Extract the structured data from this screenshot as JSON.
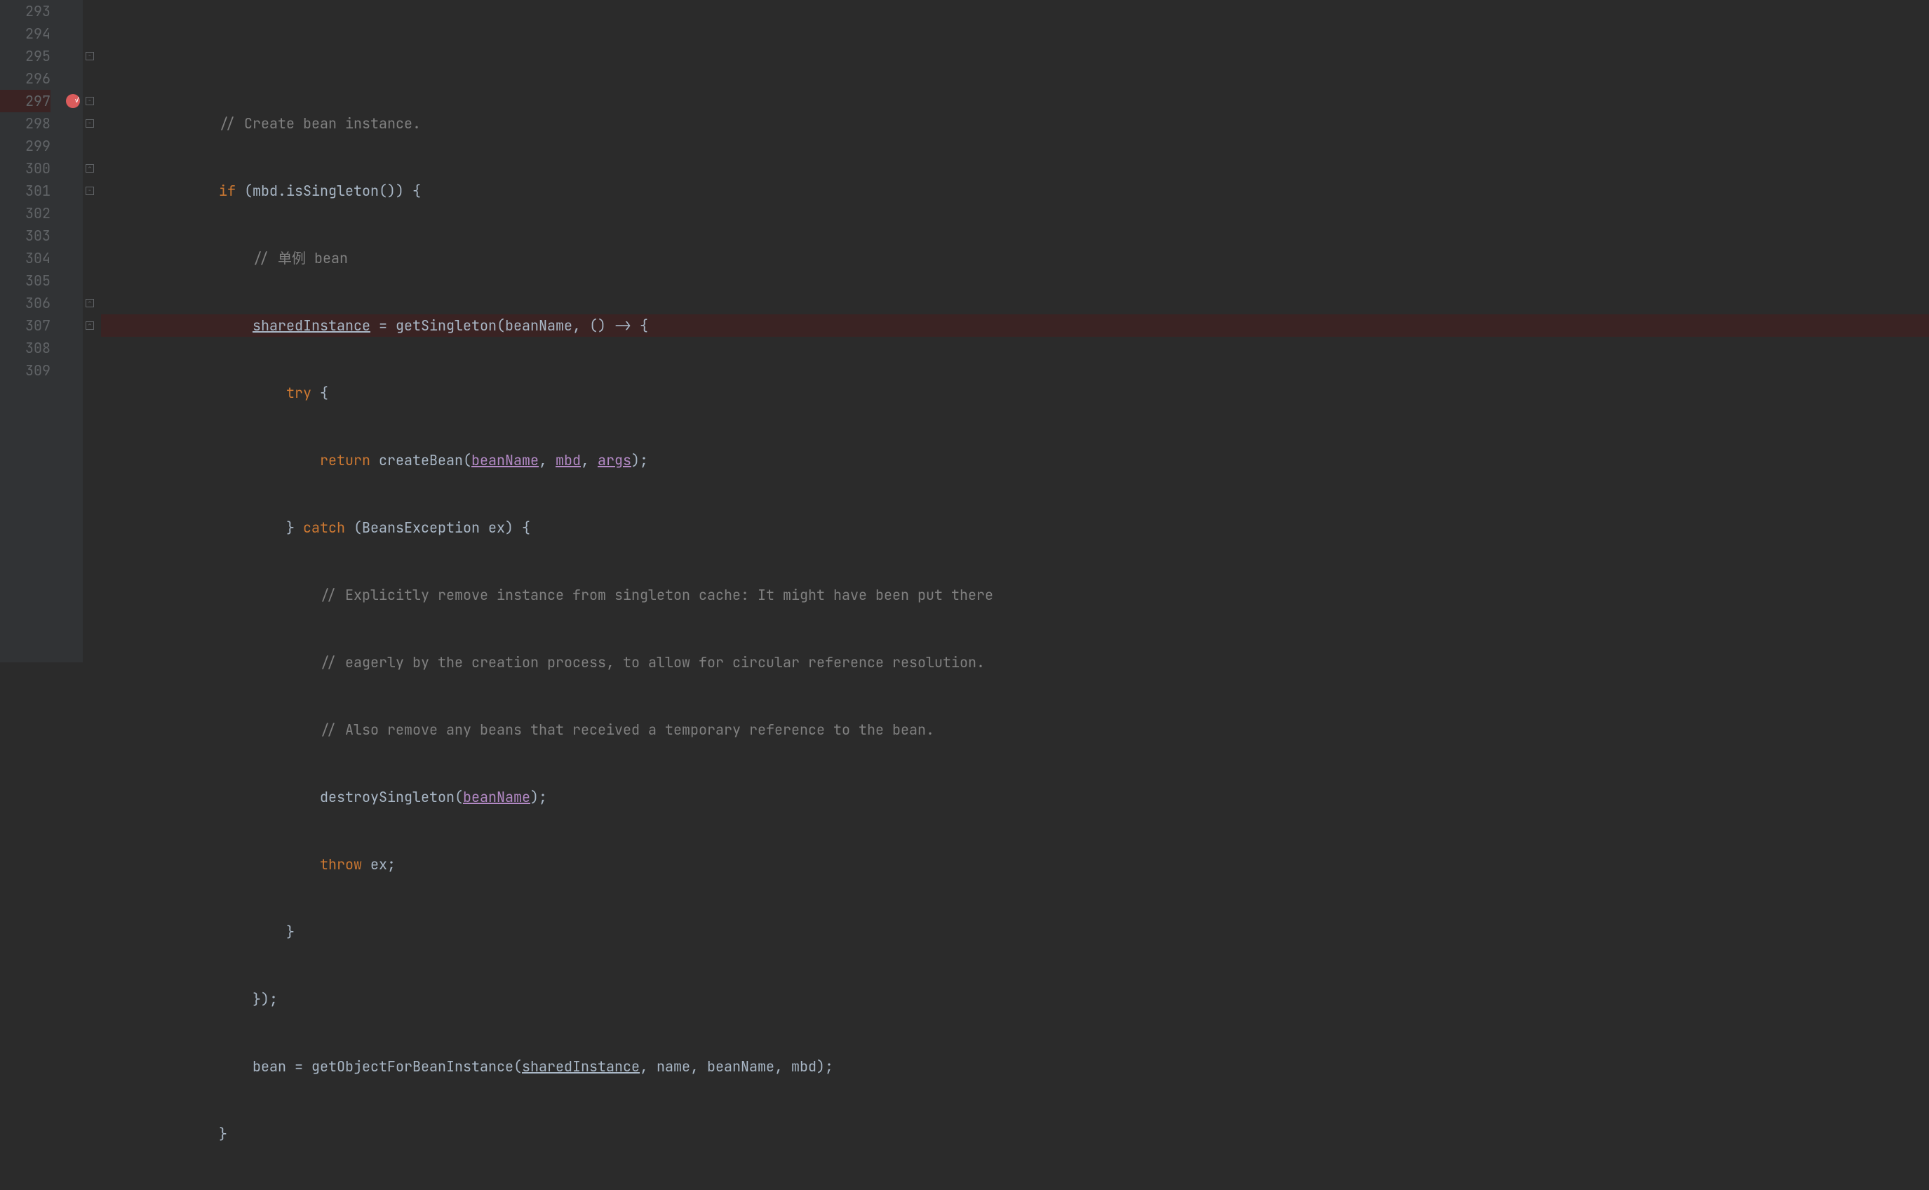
{
  "lineNumbers": [
    "293",
    "294",
    "295",
    "296",
    "297",
    "298",
    "299",
    "300",
    "301",
    "302",
    "303",
    "304",
    "305",
    "306",
    "307",
    "308",
    "309"
  ],
  "breakpointLine": "297",
  "code": {
    "l293": "",
    "l294_indent": "              ",
    "l294_comment": "// Create bean instance.",
    "l295_indent": "              ",
    "l295_if": "if",
    "l295_cond": " (mbd.isSingleton()) {",
    "l296_indent": "                  ",
    "l296_comment": "// 单例 bean",
    "l297_indent": "                  ",
    "l297_var": "sharedInstance",
    "l297_eq": " = getSingleton(beanName, () -> {",
    "l298_indent": "                      ",
    "l298_try": "try",
    "l298_brace": " {",
    "l299_indent": "                          ",
    "l299_return": "return",
    "l299_call": " createBean(",
    "l299_p1": "beanName",
    "l299_c1": ", ",
    "l299_p2": "mbd",
    "l299_c2": ", ",
    "l299_p3": "args",
    "l299_end": ");",
    "l300_indent": "                      ",
    "l300_close": "} ",
    "l300_catch": "catch",
    "l300_sig": " (BeansException ex) {",
    "l301_indent": "                          ",
    "l301_comment": "// Explicitly remove instance from singleton cache: It might have been put there",
    "l302_indent": "                          ",
    "l302_comment": "// eagerly by the creation process, to allow for circular reference resolution.",
    "l303_indent": "                          ",
    "l303_comment": "// Also remove any beans that received a temporary reference to the bean.",
    "l304_indent": "                          ",
    "l304_call": "destroySingleton(",
    "l304_p1": "beanName",
    "l304_end": ");",
    "l305_indent": "                          ",
    "l305_throw": "throw",
    "l305_ex": " ex;",
    "l306_indent": "                      ",
    "l306_brace": "}",
    "l307_indent": "                  ",
    "l307_brace": "});",
    "l308_indent": "                  ",
    "l308_assign": "bean = getObjectForBeanInstance(",
    "l308_p1": "sharedInstance",
    "l308_rest": ", name, beanName, mbd);",
    "l309_indent": "              ",
    "l309_brace": "}"
  }
}
